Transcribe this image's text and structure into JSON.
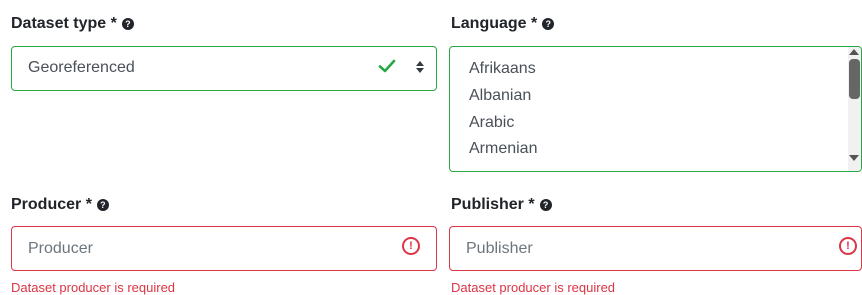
{
  "dataset_type": {
    "label": "Dataset type *",
    "value": "Georeferenced",
    "icons": {
      "help": "question-circle-icon",
      "valid": "check-icon",
      "caret": "sort-caret-icon"
    },
    "status_color": "#28a745"
  },
  "language": {
    "label": "Language *",
    "options": [
      "Afrikaans",
      "Albanian",
      "Arabic",
      "Armenian"
    ],
    "icons": {
      "help": "question-circle-icon"
    },
    "status_color": "#28a745"
  },
  "producer": {
    "label": "Producer *",
    "placeholder": "Producer",
    "error": "Dataset producer is required",
    "icons": {
      "help": "question-circle-icon",
      "invalid": "exclamation-circle-icon"
    },
    "status_color": "#dc3545"
  },
  "publisher": {
    "label": "Publisher *",
    "placeholder": "Publisher",
    "error": "Dataset producer is required",
    "icons": {
      "help": "question-circle-icon",
      "invalid": "exclamation-circle-icon"
    },
    "status_color": "#dc3545"
  }
}
